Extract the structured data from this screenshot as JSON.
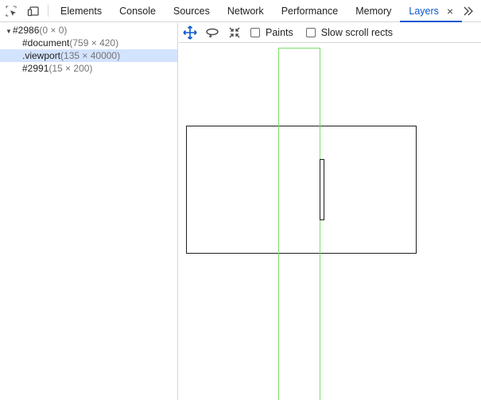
{
  "tabs": [
    {
      "label": "Elements"
    },
    {
      "label": "Console"
    },
    {
      "label": "Sources"
    },
    {
      "label": "Network"
    },
    {
      "label": "Performance"
    },
    {
      "label": "Memory"
    },
    {
      "label": "Layers",
      "active": true
    }
  ],
  "tab_close": "×",
  "tree": {
    "root": {
      "name": "#2986",
      "dims": "(0 × 0)"
    },
    "children": [
      {
        "name": "#document",
        "dims": "(759 × 420)"
      },
      {
        "name": ".viewport",
        "dims": "(135 × 40000)",
        "selected": true
      },
      {
        "name": "#2991",
        "dims": "(15 × 200)"
      }
    ]
  },
  "toolbar": {
    "paints_label": "Paints",
    "slow_scroll_label": "Slow scroll rects"
  },
  "colors": {
    "accent": "#0b57d0",
    "selection": "#d3e3fd",
    "highlight_layer": "#7ae06a"
  }
}
